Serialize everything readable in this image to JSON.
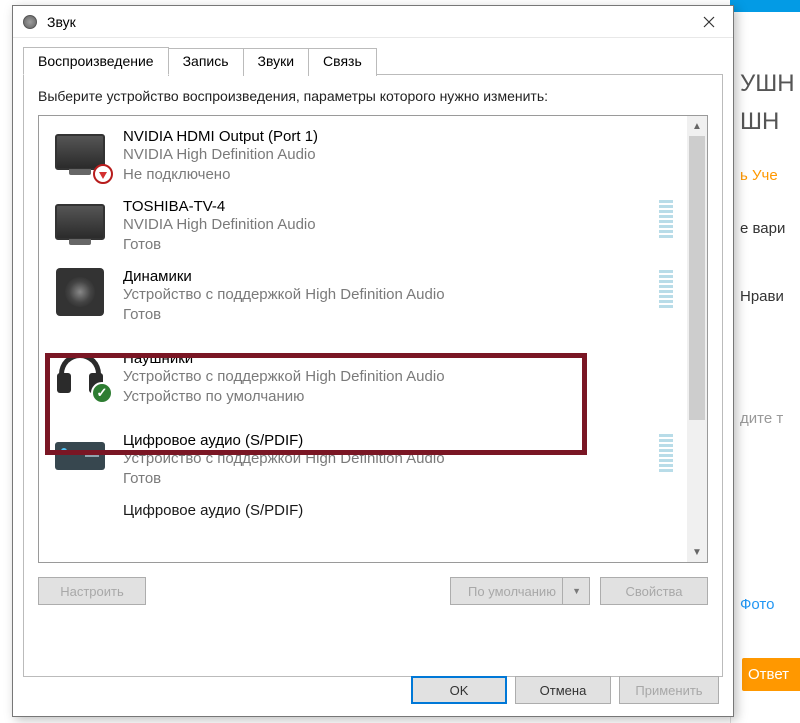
{
  "background": {
    "heading1": "УШН",
    "heading2": "ШН",
    "text1": "ь Уче",
    "text2": "е вари",
    "text3": "Нрави",
    "text4": "дите т",
    "link_photo": "Фото",
    "btn_answer": "Ответ"
  },
  "dialog": {
    "title": "Звук",
    "tabs": [
      "Воспроизведение",
      "Запись",
      "Звуки",
      "Связь"
    ],
    "active_tab": 0,
    "instruction": "Выберите устройство воспроизведения, параметры которого нужно изменить:",
    "devices": [
      {
        "name": "NVIDIA HDMI Output (Port 1)",
        "driver": "NVIDIA High Definition Audio",
        "status": "Не подключено",
        "icon": "monitor-disconnected",
        "meter": false
      },
      {
        "name": "TOSHIBA-TV-4",
        "driver": "NVIDIA High Definition Audio",
        "status": "Готов",
        "icon": "monitor",
        "meter": true
      },
      {
        "name": "Динамики",
        "driver": "Устройство с поддержкой High Definition Audio",
        "status": "Готов",
        "icon": "speaker",
        "meter": true
      },
      {
        "name": "Наушники",
        "driver": "Устройство с поддержкой High Definition Audio",
        "status": "Устройство по умолчанию",
        "icon": "headphones-default",
        "meter": true,
        "highlighted": true
      },
      {
        "name": "Цифровое аудио (S/PDIF)",
        "driver": "Устройство с поддержкой High Definition Audio",
        "status": "Готов",
        "icon": "spdif",
        "meter": true
      },
      {
        "name": "Цифровое аудио (S/PDIF)",
        "driver": "",
        "status": "",
        "icon": "",
        "meter": false
      }
    ],
    "buttons": {
      "configure": "Настроить",
      "set_default": "По умолчанию",
      "properties": "Свойства",
      "ok": "OK",
      "cancel": "Отмена",
      "apply": "Применить"
    }
  }
}
